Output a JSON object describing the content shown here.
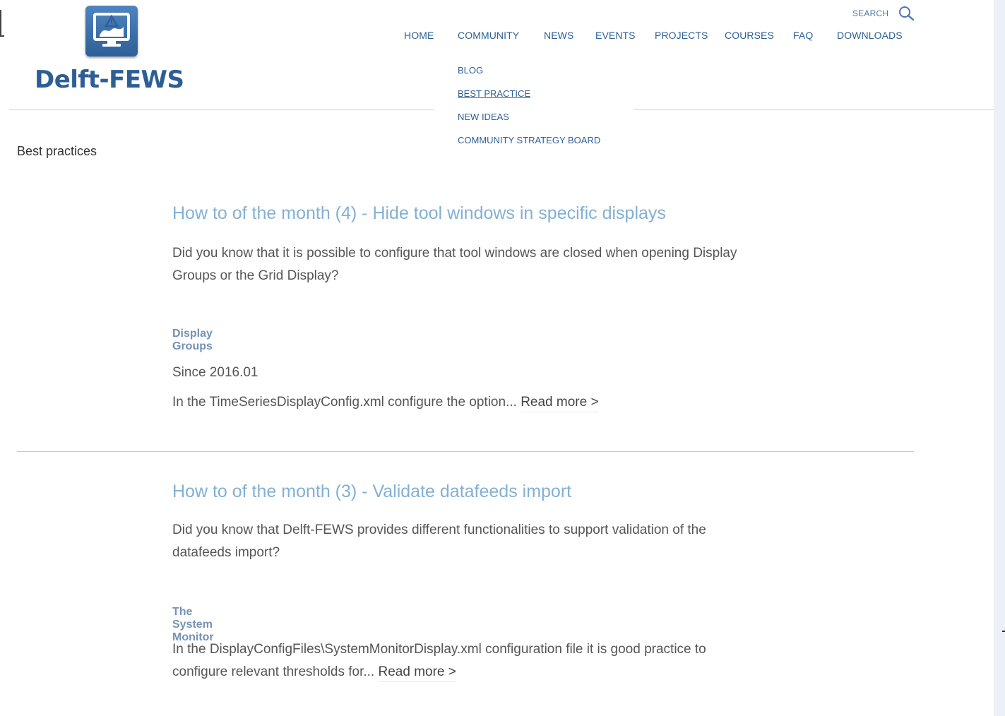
{
  "brand": {
    "name": "Delft-FEWS"
  },
  "search": {
    "label": "SEARCH",
    "icon": "magnifier"
  },
  "nav": {
    "items": [
      {
        "label": "HOME"
      },
      {
        "label": "COMMUNITY"
      },
      {
        "label": "NEWS"
      },
      {
        "label": "EVENTS"
      },
      {
        "label": "PROJECTS"
      },
      {
        "label": "COURSES"
      },
      {
        "label": "FAQ"
      },
      {
        "label": "DOWNLOADS"
      }
    ],
    "community_dropdown": [
      {
        "label": "BLOG"
      },
      {
        "label": "BEST PRACTICE",
        "active": true
      },
      {
        "label": "NEW IDEAS"
      },
      {
        "label": "COMMUNITY STRATEGY BOARD"
      }
    ]
  },
  "page": {
    "heading": "Best practices"
  },
  "articles": [
    {
      "title": "How to of the month (4) - Hide tool windows in specific displays",
      "intro": "Did you know that it is possible to configure that tool windows are closed when opening Display Groups or the Grid Display?",
      "subheading": "Display Groups",
      "line1": "Since 2016.01",
      "excerpt": "In the TimeSeriesDisplayConfig.xml configure the option...",
      "read_more": "Read more >"
    },
    {
      "title": "How to of the month (3) - Validate datafeeds import",
      "intro": "Did you know that Delft-FEWS provides different functionalities to support validation of the datafeeds import?",
      "subheading": "The System Monitor",
      "excerpt": "In the DisplayConfigFiles\\SystemMonitorDisplay.xml configuration file it is good practice to configure relevant thresholds for...",
      "read_more": "Read more >"
    }
  ],
  "colors": {
    "brand_blue": "#2d5f96",
    "title_blue": "#83b0d4",
    "subheading_blue": "#7592b6"
  }
}
